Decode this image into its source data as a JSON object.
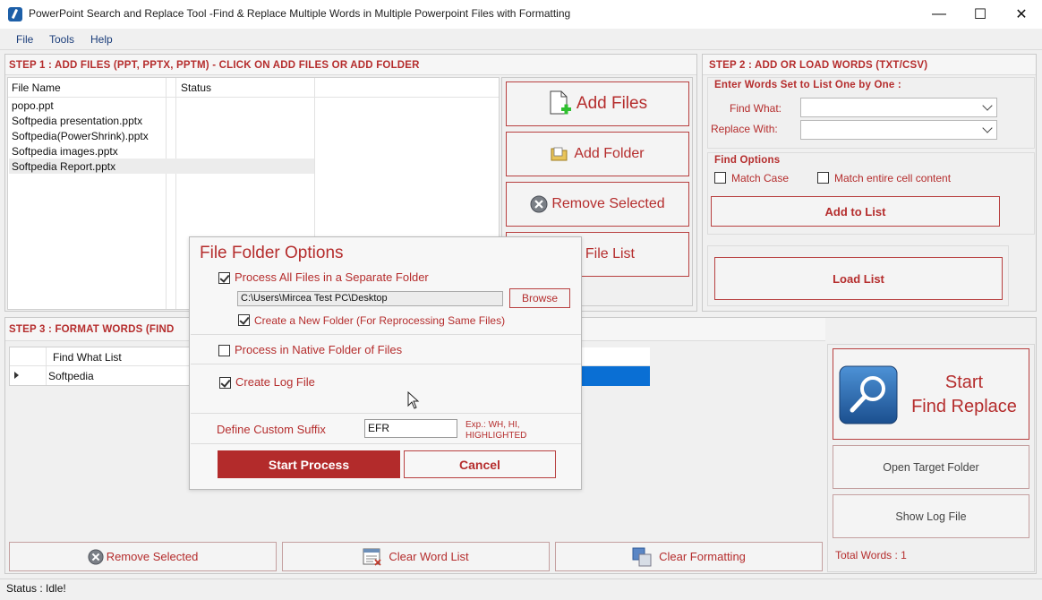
{
  "window": {
    "title": "PowerPoint Search and Replace Tool -Find & Replace Multiple Words in Multiple Powerpoint Files with Formatting",
    "minimize": "—",
    "maximize": "☐",
    "close": "✕"
  },
  "menu": {
    "file": "File",
    "tools": "Tools",
    "help": "Help"
  },
  "step1": {
    "title": "STEP 1 : ADD FILES (PPT, PPTX, PPTM) - CLICK ON ADD FILES OR ADD FOLDER",
    "columns": {
      "file_name": "File Name",
      "status": "Status"
    },
    "files": [
      {
        "name": "popo.ppt",
        "status": ""
      },
      {
        "name": "Softpedia presentation.pptx",
        "status": ""
      },
      {
        "name": "Softpedia(PowerShrink).pptx",
        "status": ""
      },
      {
        "name": "Softpedia images.pptx",
        "status": ""
      },
      {
        "name": "Softpedia Report.pptx",
        "status": ""
      }
    ],
    "add_files": "Add Files",
    "add_folder": "Add Folder",
    "remove_selected": "Remove Selected",
    "file_list": "File List"
  },
  "step2": {
    "title": "STEP 2 : ADD OR LOAD WORDS (TXT/CSV)",
    "subtitle": "Enter Words Set to List One by One :",
    "find_what": "Find What:",
    "replace_with": "Replace With:",
    "find_value": "",
    "replace_value": "",
    "find_options": "Find Options",
    "match_case": "Match Case",
    "match_entire": "Match entire cell content",
    "add_to_list": "Add to List",
    "load_list": "Load List"
  },
  "step3": {
    "title": "STEP 3 : FORMAT WORDS (FIND",
    "column": "Find What List",
    "rows": [
      {
        "value": "Softpedia"
      }
    ],
    "remove_selected": "Remove Selected",
    "clear_word_list": "Clear Word List",
    "clear_formatting": "Clear Formatting"
  },
  "right": {
    "start_line1": "Start",
    "start_line2": "Find Replace",
    "open_target": "Open Target Folder",
    "show_log": "Show Log File",
    "total_words": "Total Words : 1"
  },
  "dialog": {
    "title": "File Folder Options",
    "process_separate": "Process All Files in a Separate Folder",
    "process_separate_checked": true,
    "path": "C:\\Users\\Mircea Test PC\\Desktop",
    "browse": "Browse",
    "create_new_folder": "Create a New Folder (For Reprocessing Same Files)",
    "create_new_folder_checked": true,
    "process_native": "Process in Native Folder of Files",
    "process_native_checked": false,
    "create_log": "Create Log File",
    "create_log_checked": true,
    "suffix_label": "Define Custom Suffix",
    "suffix_value": "EFR",
    "suffix_hint": "Exp.: WH, HI, HIGHLIGHTED",
    "start": "Start Process",
    "cancel": "Cancel"
  },
  "status": {
    "text": "Status :  Idle!"
  },
  "colors": {
    "accent": "#b52d2d",
    "progress": "#0a6fd4"
  }
}
